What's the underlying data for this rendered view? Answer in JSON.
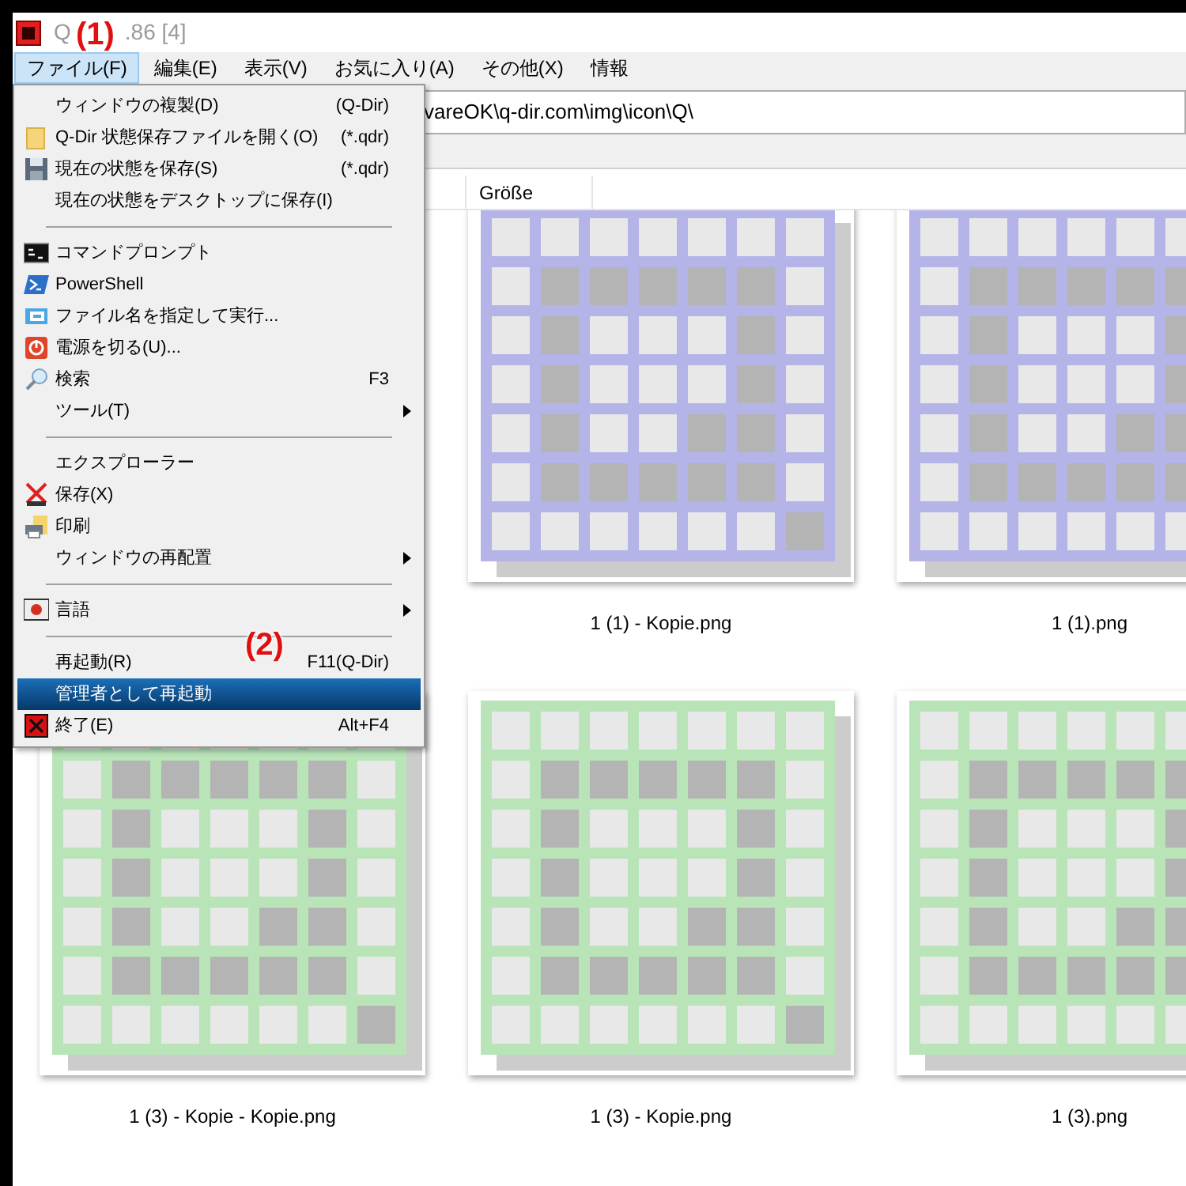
{
  "window": {
    "title_fragments": [
      "Q",
      ".86 [4]"
    ]
  },
  "annotations": [
    {
      "label": "(1)"
    },
    {
      "label": "(2)"
    }
  ],
  "menu_bar": [
    {
      "label": "ファイル(F)",
      "selected": true
    },
    {
      "label": "編集(E)",
      "selected": false
    },
    {
      "label": "表示(V)",
      "selected": false
    },
    {
      "label": "お気に入り(A)",
      "selected": false
    },
    {
      "label": "その他(X)",
      "selected": false
    },
    {
      "label": "情報",
      "selected": false
    }
  ],
  "address_bar": {
    "value": "vareOK\\q-dir.com\\img\\icon\\Q\\"
  },
  "columns": [
    "Größe"
  ],
  "file_menu": [
    {
      "kind": "item",
      "label": "ウィンドウの複製(D)",
      "shortcut": "(Q-Dir)",
      "submenu": false,
      "selected": false
    },
    {
      "kind": "item",
      "label": "Q-Dir 状態保存ファイルを開く(O)",
      "shortcut": "(*.qdr)",
      "submenu": false,
      "selected": false
    },
    {
      "kind": "item",
      "label": "現在の状態を保存(S)",
      "shortcut": "(*.qdr)",
      "submenu": false,
      "selected": false
    },
    {
      "kind": "item",
      "label": "現在の状態をデスクトップに保存(I)",
      "submenu": false,
      "selected": false
    },
    {
      "kind": "separator"
    },
    {
      "kind": "item",
      "label": "コマンドプロンプト",
      "submenu": false,
      "selected": false
    },
    {
      "kind": "item",
      "label": "PowerShell",
      "submenu": false,
      "selected": false
    },
    {
      "kind": "item",
      "label": "ファイル名を指定して実行...",
      "submenu": false,
      "selected": false
    },
    {
      "kind": "item",
      "label": "電源を切る(U)...",
      "submenu": false,
      "selected": false
    },
    {
      "kind": "item",
      "label": "検索",
      "shortcut": "F3",
      "submenu": false,
      "selected": false
    },
    {
      "kind": "item",
      "label": "ツール(T)",
      "submenu": true,
      "selected": false
    },
    {
      "kind": "separator"
    },
    {
      "kind": "item",
      "label": "エクスプローラー",
      "submenu": false,
      "selected": false
    },
    {
      "kind": "item",
      "label": "保存(X)",
      "submenu": false,
      "selected": false
    },
    {
      "kind": "item",
      "label": "印刷",
      "submenu": false,
      "selected": false
    },
    {
      "kind": "item",
      "label": "ウィンドウの再配置",
      "submenu": true,
      "selected": false
    },
    {
      "kind": "separator"
    },
    {
      "kind": "item",
      "label": "言語",
      "submenu": true,
      "selected": false
    },
    {
      "kind": "separator"
    },
    {
      "kind": "item",
      "label": "再起動(R)",
      "shortcut": "F11(Q-Dir)",
      "submenu": false,
      "selected": false
    },
    {
      "kind": "item",
      "label": "管理者として再起動",
      "submenu": false,
      "selected": true
    },
    {
      "kind": "item",
      "label": "終了(E)",
      "shortcut": "Alt+F4",
      "submenu": false,
      "selected": false
    }
  ],
  "thumbnails": [
    {
      "name": "1 (1) - Kopie.png",
      "color": "#b4b4e8"
    },
    {
      "name": "1 (1).png",
      "color": "#b4b4e8"
    },
    {
      "name": "1 (3) - Kopie - Kopie.png",
      "color": "#b8e4b8"
    },
    {
      "name": "1 (3) - Kopie.png",
      "color": "#b8e4b8"
    },
    {
      "name": "1 (3).png",
      "color": "#b8e4b8"
    }
  ]
}
